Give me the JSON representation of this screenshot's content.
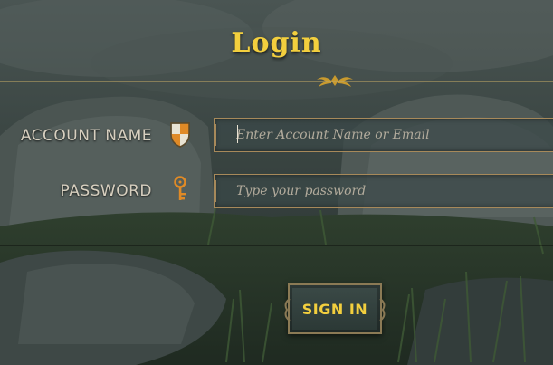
{
  "header": {
    "title": "Login"
  },
  "form": {
    "account": {
      "label": "ACCOUNT NAME",
      "placeholder": "Enter Account Name or Email",
      "value": ""
    },
    "password": {
      "label": "PASSWORD",
      "placeholder": "Type your password",
      "value": ""
    },
    "submit_label": "SIGN IN"
  },
  "icons": {
    "account": "shield-icon",
    "password": "key-icon",
    "divider": "ornament-icon"
  },
  "colors": {
    "accent": "#f3cf3e",
    "label": "#d7cfbf",
    "border": "#a7895a",
    "shield_orange": "#e08a26"
  }
}
